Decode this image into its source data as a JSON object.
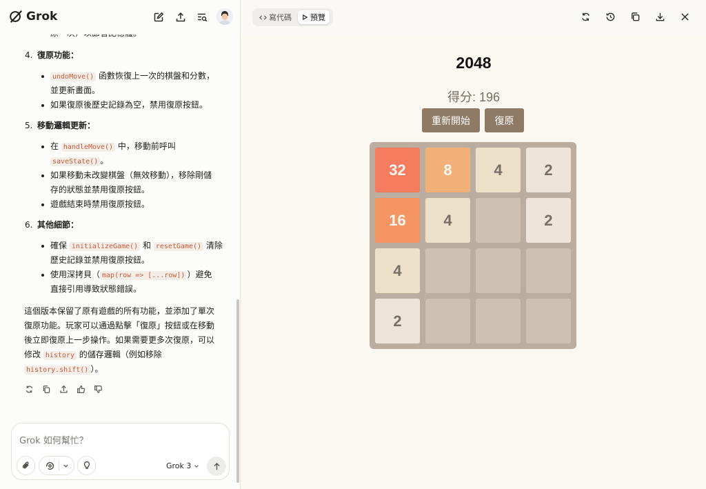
{
  "brand": {
    "name": "Grok"
  },
  "chat": {
    "intro_tail": "原一次）以節省記憶體。",
    "sections": [
      {
        "num": "4.",
        "title": "復原功能："
      },
      {
        "num": "5.",
        "title": "移動邏輯更新："
      },
      {
        "num": "6.",
        "title": "其他細節："
      }
    ],
    "s4": {
      "b1_code": "undoMove()",
      "b1_text": " 函數恢復上一次的棋盤和分數，",
      "b1_l2": "並更新畫面。",
      "b2": "如果復原後歷史記錄為空，禁用復原按鈕。"
    },
    "s5": {
      "b1_pre": "在 ",
      "b1_code": "handleMove()",
      "b1_text": " 中，移動前呼叫",
      "b1_l2_code": "saveState()",
      "b1_l2_text": "。",
      "b2_l1": "如果移動未改變棋盤（無效移動），移除剛儲",
      "b2_l2": "存的狀態並禁用復原按鈕。",
      "b3": "遊戲結束時禁用復原按鈕。"
    },
    "s6": {
      "b1_pre": "確保 ",
      "b1_code1": "initializeGame()",
      "b1_mid": " 和 ",
      "b1_code2": "resetGame()",
      "b1_text": " 清除",
      "b1_l2": "歷史記錄並禁用復原按鈕。",
      "b2_pre": "使用深拷貝（",
      "b2_code": "map(row => [...row])",
      "b2_text": "）避免",
      "b2_l2": "直接引用導致狀態錯誤。"
    },
    "summary": {
      "l1": "這個版本保留了原有遊戲的所有功能，並添加了單次",
      "l2": "復原功能。玩家可以通過點擊「復原」按鈕或在移動",
      "l3": "後立即復原上一步操作。如果需要更多次復原，可以",
      "l4_pre": "修改 ",
      "l4_code": "history",
      "l4_text": " 的儲存邏輯（例如移除",
      "l5_code": "history.shift()",
      "l5_text": "）。"
    }
  },
  "composer": {
    "placeholder": "Grok 如何幫忙？",
    "model": "Grok 3"
  },
  "preview": {
    "tabs": [
      {
        "label": "寫代碼"
      },
      {
        "label": "預覽"
      }
    ],
    "active_tab": "預覽"
  },
  "game": {
    "title": "2048",
    "score_text": "得分: 196",
    "buttons": {
      "restart": "重新開始",
      "undo": "復原"
    },
    "grid": [
      [
        32,
        8,
        4,
        2
      ],
      [
        16,
        4,
        0,
        2
      ],
      [
        4,
        0,
        0,
        0
      ],
      [
        2,
        0,
        0,
        0
      ]
    ],
    "tile_colors": {
      "2": {
        "bg": "#eee4da",
        "fg": "#776e65"
      },
      "4": {
        "bg": "#ede0c8",
        "fg": "#776e65"
      },
      "8": {
        "bg": "#f2b179",
        "fg": "#f9f6f2"
      },
      "16": {
        "bg": "#f59563",
        "fg": "#f9f6f2"
      },
      "32": {
        "bg": "#f67c5f",
        "fg": "#f9f6f2"
      }
    }
  }
}
